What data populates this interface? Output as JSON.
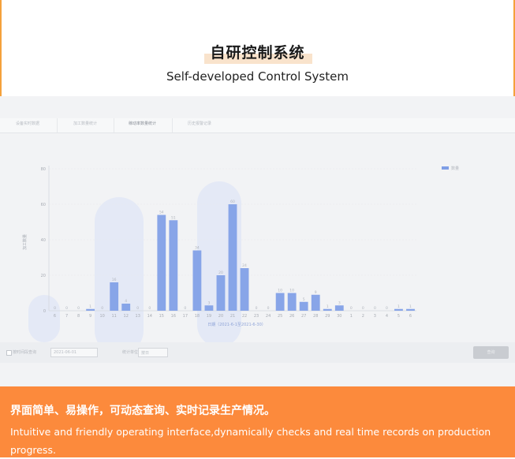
{
  "header": {
    "title_zh": "自研控制系统",
    "title_en": "Self-developed Control System"
  },
  "screenshot": {
    "tabs": [
      "设备实时数据",
      "加工数量统计",
      "稼动率数量统计",
      "历史报警记录"
    ],
    "bottom": {
      "checkbox_label": "按时间段查询",
      "date_value": "2021-06-01",
      "filter_label": "统计单位",
      "select_value": "按日",
      "button_label": "查询"
    }
  },
  "chart_data": {
    "type": "bar",
    "title": "",
    "xlabel": "日期（2021-6-1至2021-6-30）",
    "ylabel": "加工数量",
    "ylim": [
      0,
      80
    ],
    "yticks": [
      0,
      20,
      40,
      60,
      80
    ],
    "legend": {
      "label": "数量",
      "position": "top-right"
    },
    "categories": [
      "6",
      "7",
      "8",
      "9",
      "10",
      "11",
      "12",
      "13",
      "14",
      "15",
      "16",
      "17",
      "18",
      "19",
      "20",
      "21",
      "22",
      "23",
      "24",
      "25",
      "26",
      "27",
      "28",
      "29",
      "30",
      "1",
      "2",
      "3",
      "4",
      "5",
      "6"
    ],
    "values": [
      0,
      0,
      0,
      1,
      0,
      16,
      4,
      0,
      0,
      54,
      51,
      0,
      34,
      3,
      20,
      60,
      24,
      0,
      0,
      10,
      10,
      5,
      9,
      1,
      3,
      0,
      0,
      0,
      0,
      1,
      1
    ],
    "color": "#7f9ee6"
  },
  "footer": {
    "text_zh": "界面简单、易操作，可动态查询、实时记录生产情况。",
    "text_en": "Intuitive and friendly operating interface,dynamically checks and real time records on production progress."
  }
}
